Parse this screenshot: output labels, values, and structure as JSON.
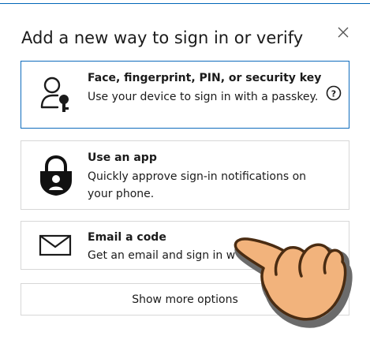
{
  "dialog": {
    "title": "Add a new way to sign in or verify",
    "close_icon": "close-icon"
  },
  "options": [
    {
      "title": "Face, fingerprint, PIN, or security key",
      "description": "Use your device to sign in with a passkey.",
      "icon": "person-key-icon",
      "help_icon": "help-icon"
    },
    {
      "title": "Use an app",
      "description": "Quickly approve sign-in notifications on your phone.",
      "icon": "authenticator-lock-icon"
    },
    {
      "title": "Email a code",
      "description": "Get an email and sign in w",
      "icon": "envelope-icon"
    }
  ],
  "show_more_label": "Show more options",
  "colors": {
    "accent": "#0f6cbd",
    "border": "#d7d7d7",
    "text": "#1b1b1b"
  }
}
